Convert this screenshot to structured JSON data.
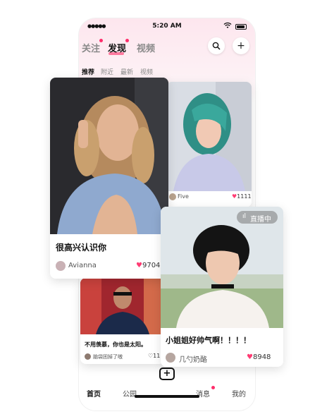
{
  "status_bar": {
    "signal": "●●●●●",
    "time": "5:20 AM"
  },
  "top_tabs": [
    {
      "label": "关注",
      "has_dot": true
    },
    {
      "label": "发现",
      "has_dot": true,
      "active": true
    },
    {
      "label": "视频",
      "has_dot": false
    }
  ],
  "header_actions": {
    "search_icon": "search-icon",
    "add_icon": "plus-icon",
    "add_glyph": "+"
  },
  "sub_tabs": [
    {
      "label": "推荐",
      "active": true
    },
    {
      "label": "附近"
    },
    {
      "label": "最新"
    },
    {
      "label": "视频"
    }
  ],
  "cards": {
    "main": {
      "title": "很高兴认识你",
      "author": "Avianna",
      "likes": "9704"
    },
    "right_top": {
      "author": "Five",
      "likes": "1111"
    },
    "live": {
      "badge": "直播中",
      "title": "小姐姐好帅气啊！！！！",
      "author": "几勺奶酪",
      "likes": "8948"
    },
    "bottom_left": {
      "title": "不用羡慕，你也是太阳。",
      "author": "脑袋困掉了嗷",
      "likes": "11"
    }
  },
  "bottom_nav": [
    {
      "label": "首页",
      "active": true
    },
    {
      "label": "公园"
    },
    {
      "label": "消息",
      "has_dot": true
    },
    {
      "label": "我的"
    }
  ],
  "colors": {
    "accent": "#ff2d6b",
    "heart": "#ff3b73",
    "header_gradient_top": "#fde6ee"
  }
}
